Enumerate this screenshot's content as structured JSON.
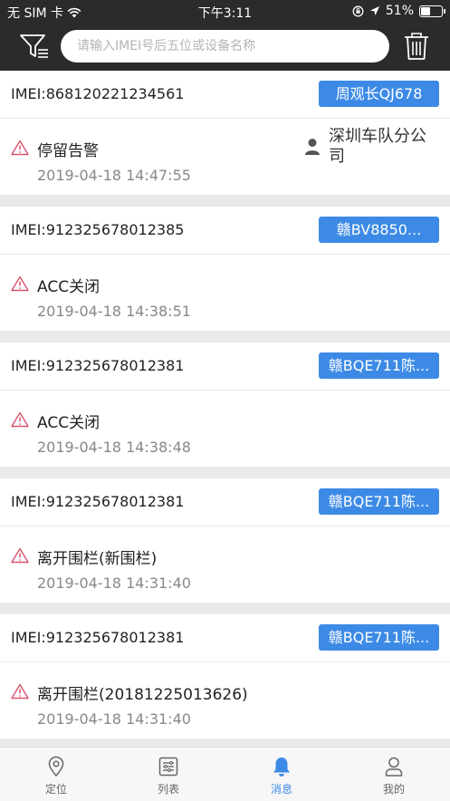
{
  "status_bar": {
    "carrier": "无 SIM 卡",
    "time": "下午3:11",
    "battery": "51%",
    "battery_level": 0.51
  },
  "search": {
    "placeholder": "请输入IMEI号后五位或设备名称"
  },
  "messages": [
    {
      "imei": "IMEI:868120221234561",
      "plate": "周观长QJ678",
      "alarm": "停留告警",
      "time": "2019-04-18 14:47:55",
      "company": "深圳车队分公司"
    },
    {
      "imei": "IMEI:912325678012385",
      "plate": "赣BV8850...",
      "alarm": "ACC关闭",
      "time": "2019-04-18 14:38:51"
    },
    {
      "imei": "IMEI:912325678012381",
      "plate": "赣BQE711陈...",
      "alarm": "ACC关闭",
      "time": "2019-04-18 14:38:48"
    },
    {
      "imei": "IMEI:912325678012381",
      "plate": "赣BQE711陈...",
      "alarm": "离开围栏(新围栏)",
      "time": "2019-04-18 14:31:40"
    },
    {
      "imei": "IMEI:912325678012381",
      "plate": "赣BQE711陈...",
      "alarm": "离开围栏(20181225013626)",
      "time": "2019-04-18 14:31:40"
    }
  ],
  "tabs": [
    {
      "label": "定位",
      "icon": "location-pin-icon",
      "active": false
    },
    {
      "label": "列表",
      "icon": "list-icon",
      "active": false
    },
    {
      "label": "消息",
      "icon": "bell-icon",
      "active": true
    },
    {
      "label": "我的",
      "icon": "person-icon",
      "active": false
    }
  ],
  "colors": {
    "header_bg": "#2b2b2b",
    "accent": "#3d8ae6",
    "alarm_icon": "#d9536f"
  }
}
